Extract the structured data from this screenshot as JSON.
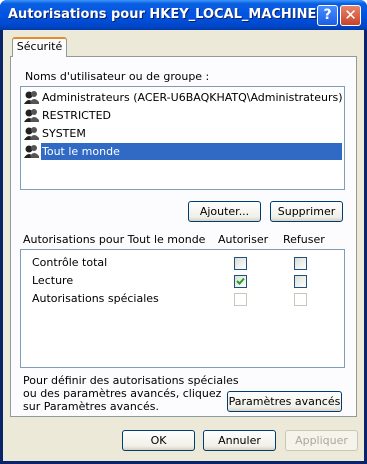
{
  "window": {
    "title": "Autorisations pour HKEY_LOCAL_MACHINE",
    "help_glyph": "?",
    "close_glyph": "✕"
  },
  "tabs": [
    {
      "label": "Sécurité",
      "active": true
    }
  ],
  "users_section": {
    "label": "Noms d'utilisateur ou de groupe :",
    "items": [
      {
        "name": "Administrateurs (ACER-U6BAQKHATQ\\Administrateurs)",
        "icon": "users-group-icon",
        "selected": false
      },
      {
        "name": "RESTRICTED",
        "icon": "users-group-icon",
        "selected": false
      },
      {
        "name": "SYSTEM",
        "icon": "users-group-icon",
        "selected": false
      },
      {
        "name": "Tout le monde",
        "icon": "users-group-icon",
        "selected": true
      }
    ]
  },
  "buttons": {
    "add": "Ajouter...",
    "remove": "Supprimer",
    "advanced": "Paramètres avancés",
    "ok": "OK",
    "cancel": "Annuler",
    "apply": "Appliquer"
  },
  "permissions": {
    "header": "Autorisations pour Tout le monde",
    "col_allow": "Autoriser",
    "col_deny": "Refuser",
    "rows": [
      {
        "name": "Contrôle total",
        "allow": false,
        "deny": false,
        "enabled": true
      },
      {
        "name": "Lecture",
        "allow": true,
        "deny": false,
        "enabled": true
      },
      {
        "name": "Autorisations spéciales",
        "allow": false,
        "deny": false,
        "enabled": false
      }
    ]
  },
  "advanced_note": "Pour définir des autorisations spéciales ou des paramètres avancés, cliquez sur Paramètres avancés.",
  "advanced_note_lines": [
    "Pour définir des autorisations spéciales",
    "ou des paramètres avancés, cliquez",
    "sur Paramètres avancés."
  ],
  "colors": {
    "titlebar": "#0054e3",
    "selection": "#316ac5",
    "face": "#ece9d8"
  }
}
